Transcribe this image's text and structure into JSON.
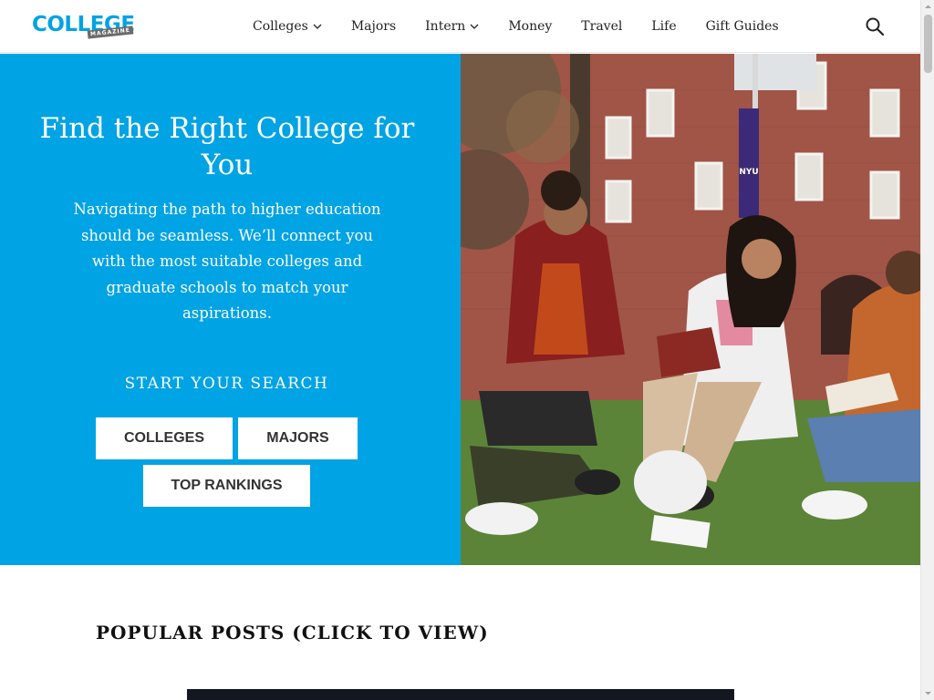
{
  "brand": {
    "logo_main": "COLLEGE",
    "logo_sub": "MAGAZINE",
    "accent": "#00a3e4"
  },
  "nav": {
    "items": [
      {
        "label": "Colleges",
        "has_dropdown": true
      },
      {
        "label": "Majors",
        "has_dropdown": false
      },
      {
        "label": "Intern",
        "has_dropdown": true
      },
      {
        "label": "Money",
        "has_dropdown": false
      },
      {
        "label": "Travel",
        "has_dropdown": false
      },
      {
        "label": "Life",
        "has_dropdown": false
      },
      {
        "label": "Gift Guides",
        "has_dropdown": false
      }
    ],
    "search_icon": "search-icon"
  },
  "hero": {
    "title": "Find the Right College for You",
    "description": "Navigating the path to higher education should be seamless. We’ll connect you with the most suitable colleges and graduate schools to match your aspirations.",
    "start_search": "START YOUR SEARCH",
    "buttons": {
      "colleges": "COLLEGES",
      "majors": "MAJORS",
      "rankings": "TOP RANKINGS"
    },
    "photo_banner_text": "NYU"
  },
  "popular": {
    "title": "POPULAR POSTS (CLICK TO VIEW)"
  }
}
